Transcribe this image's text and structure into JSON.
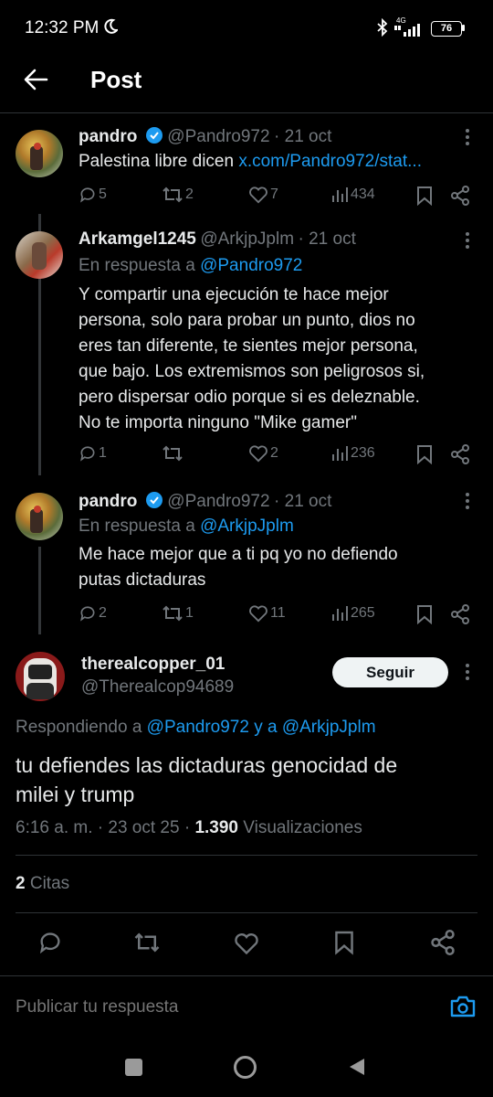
{
  "status_bar": {
    "time": "12:32 PM",
    "network": "4G",
    "battery": "76"
  },
  "header": {
    "title": "Post"
  },
  "tweets": [
    {
      "name": "pandro",
      "handle": "@Pandro972",
      "date": "· 21 oct",
      "text": "Palestina libre dicen ",
      "link": "x.com/Pandro972/stat...",
      "replies": "5",
      "retweets": "2",
      "likes": "7",
      "views": "434"
    },
    {
      "name": "Arkamgel1245",
      "handle": "@ArkjpJplm",
      "date": "· 21 oct",
      "reply_prefix": "En respuesta a ",
      "reply_to": "@Pandro972",
      "lines": [
        "Y compartir una ejecución te hace mejor",
        "persona, solo para probar un punto, dios no",
        "eres tan diferente, te sientes mejor persona,",
        "que bajo. Los extremismos son peligrosos si,",
        "pero dispersar odio porque si es deleznable.",
        "No te importa ninguno \"Mike gamer\""
      ],
      "replies": "1",
      "retweets": "",
      "likes": "2",
      "views": "236"
    },
    {
      "name": "pandro",
      "handle": "@Pandro972",
      "date": "· 21 oct",
      "reply_prefix": "En respuesta a ",
      "reply_to": "@ArkjpJplm",
      "lines": [
        "Me hace mejor que a ti pq yo no defiendo",
        "putas dictaduras"
      ],
      "replies": "2",
      "retweets": "1",
      "likes": "11",
      "views": "265"
    }
  ],
  "main_post": {
    "name": "therealcopper_01",
    "handle": "@Therealcop94689",
    "follow_label": "Seguir",
    "replying_prefix": "Respondiendo a ",
    "replying_to": "@Pandro972 y a @ArkjpJplm",
    "lines": [
      "tu defiendes las dictaduras genocidad de",
      "milei y trump"
    ],
    "timestamp": "6:16 a. m. · 23 oct 25 · ",
    "views_count": "1.390",
    "views_label": " Visualizaciones",
    "quotes_count": "2",
    "quotes_label": " Citas"
  },
  "reply_box": {
    "placeholder": "Publicar tu respuesta"
  },
  "colors": {
    "accent": "#1d9bf0",
    "background": "#000000",
    "muted": "#71767b"
  }
}
